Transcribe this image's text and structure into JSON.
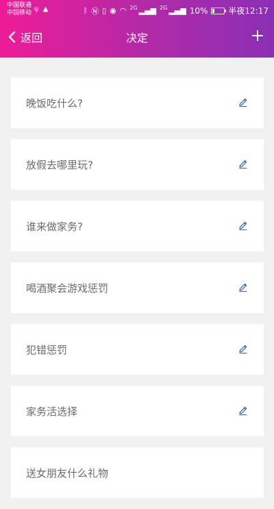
{
  "status_bar": {
    "carrier_1": "中国联通",
    "carrier_2": "中国移动",
    "network_1": "2G",
    "network_2": "2G",
    "battery": "10%",
    "time": "半夜12:17",
    "icons": [
      "usb-icon",
      "notification-icon",
      "bluetooth-icon",
      "nfc-icon",
      "vibrate-icon",
      "eye-comfort-icon",
      "wifi-icon",
      "signal-icon",
      "battery-icon"
    ]
  },
  "navbar": {
    "back_label": "返回",
    "title": "决定",
    "add_icon": "plus-icon",
    "back_icon": "chevron-left-icon"
  },
  "items": [
    {
      "label": "晚饭吃什么?"
    },
    {
      "label": "放假去哪里玩?"
    },
    {
      "label": "谁来做家务?"
    },
    {
      "label": "喝酒聚会游戏惩罚"
    },
    {
      "label": "犯错惩罚"
    },
    {
      "label": "家务活选择"
    },
    {
      "label": "送女朋友什么礼物"
    }
  ],
  "colors": {
    "header_start": "#ee1c97",
    "header_end": "#8a2fb5",
    "edit_icon": "#2d6fc0",
    "background": "#f0f0f0"
  }
}
